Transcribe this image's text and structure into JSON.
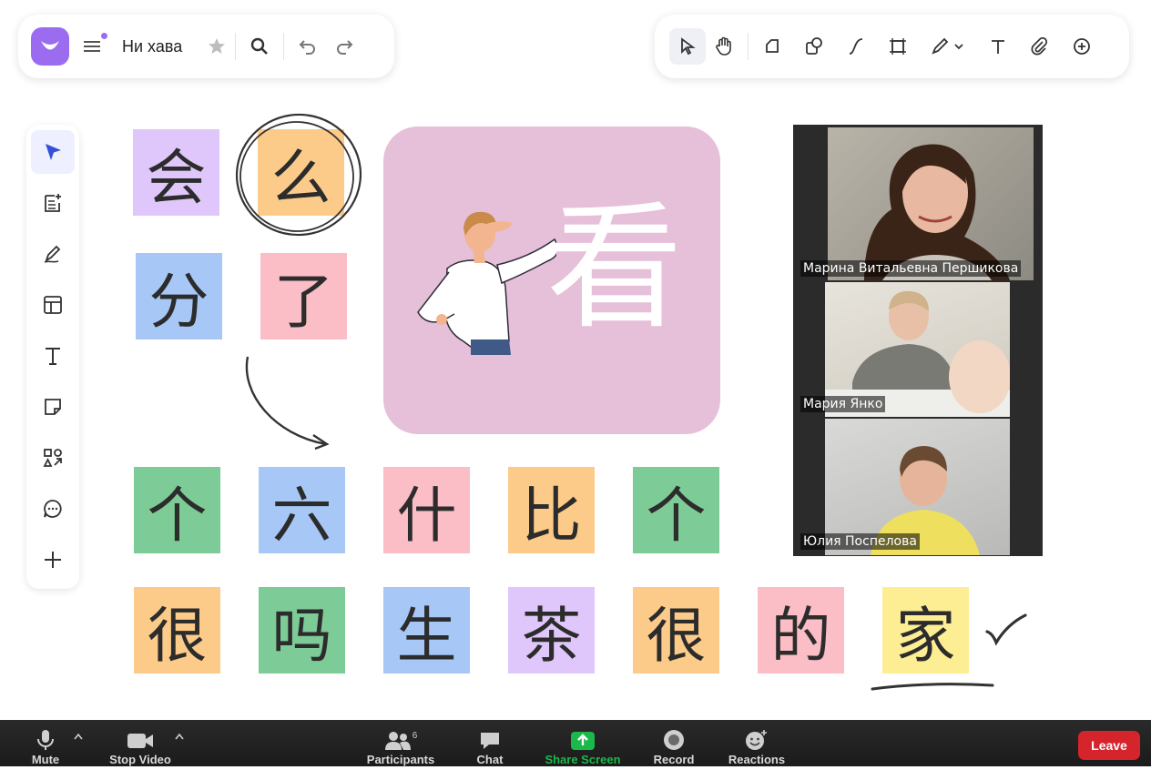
{
  "board": {
    "title": "Ни хава"
  },
  "tiles": {
    "row1": [
      {
        "char": "会",
        "color": "#dfc7fb"
      },
      {
        "char": "么",
        "color": "#fdcb89"
      }
    ],
    "row2": [
      {
        "char": "分",
        "color": "#a7c8f7"
      },
      {
        "char": "了",
        "color": "#fbbdc6"
      }
    ],
    "big_card": {
      "char": "看",
      "color": "#e6bfd8"
    },
    "row3": [
      {
        "char": "个",
        "color": "#7dcb96"
      },
      {
        "char": "六",
        "color": "#a7c8f7"
      },
      {
        "char": "什",
        "color": "#fbbdc6"
      },
      {
        "char": "比",
        "color": "#fdcb89"
      },
      {
        "char": "个",
        "color": "#7dcb96"
      }
    ],
    "row4": [
      {
        "char": "很",
        "color": "#fdcb89"
      },
      {
        "char": "吗",
        "color": "#7dcb96"
      },
      {
        "char": "生",
        "color": "#a7c8f7"
      },
      {
        "char": "茶",
        "color": "#dfc7fb"
      },
      {
        "char": "很",
        "color": "#fdcb89"
      },
      {
        "char": "的",
        "color": "#fbbdc6"
      },
      {
        "char": "家",
        "color": "#fdee94"
      }
    ]
  },
  "participants": [
    {
      "name": "Марина Витальевна Першикова"
    },
    {
      "name": "Мария Янко"
    },
    {
      "name": "Юлия Поспелова"
    }
  ],
  "zoom_bar": {
    "mute": "Mute",
    "stop_video": "Stop Video",
    "participants": "Participants",
    "participants_count": "6",
    "chat": "Chat",
    "share_screen": "Share Screen",
    "record": "Record",
    "reactions": "Reactions",
    "leave": "Leave"
  },
  "colors": {
    "accent": "#9b6cf0",
    "share_green": "#1bb84a",
    "leave_red": "#d6242d"
  }
}
